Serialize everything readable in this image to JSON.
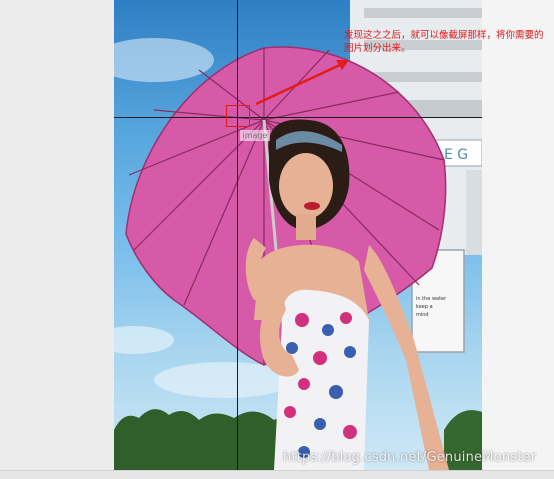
{
  "overlay": {
    "hint_text": "发现这之之后，就可以像截屏那样，将你需要的图片划分出来。",
    "image_tag": "image",
    "watermark": "https://blog.csdn.net/GenuineMonster"
  },
  "photo": {
    "sign_text": "E G",
    "sign_notes": [
      "in the water",
      "keep a",
      "mind"
    ]
  },
  "colors": {
    "accent_red": "#e21b1b",
    "umbrella_pink": "#d65aa8",
    "sky": "#59a8df"
  }
}
